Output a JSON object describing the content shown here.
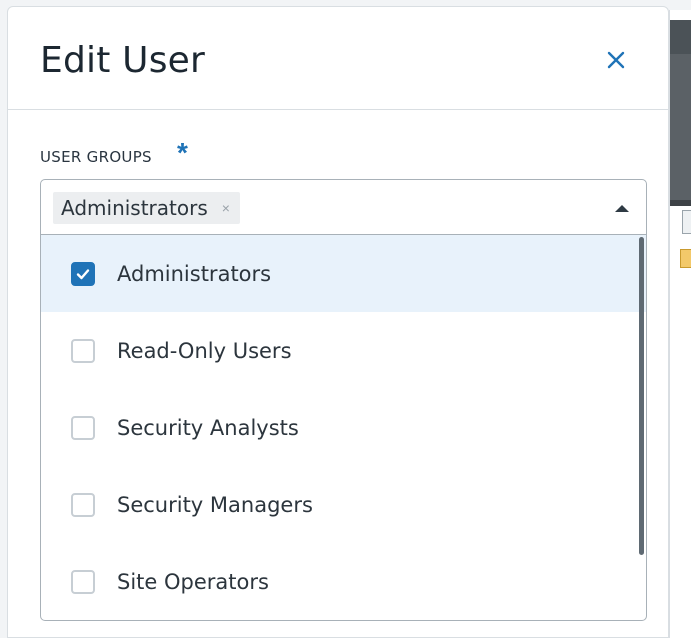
{
  "modal": {
    "title": "Edit User",
    "close_icon": "close-icon"
  },
  "user_groups": {
    "label": "USER GROUPS",
    "required_marker": "*",
    "selected_chips": [
      {
        "label": "Administrators",
        "remove_glyph": "×"
      }
    ],
    "options": [
      {
        "label": "Administrators",
        "checked": true
      },
      {
        "label": "Read-Only Users",
        "checked": false
      },
      {
        "label": "Security Analysts",
        "checked": false
      },
      {
        "label": "Security Managers",
        "checked": false
      },
      {
        "label": "Site Operators",
        "checked": false
      }
    ],
    "dropdown_state": "open"
  },
  "colors": {
    "accent": "#1f73b7",
    "selected_row_bg": "#e8f2fb",
    "border": "#a8b1b8"
  }
}
